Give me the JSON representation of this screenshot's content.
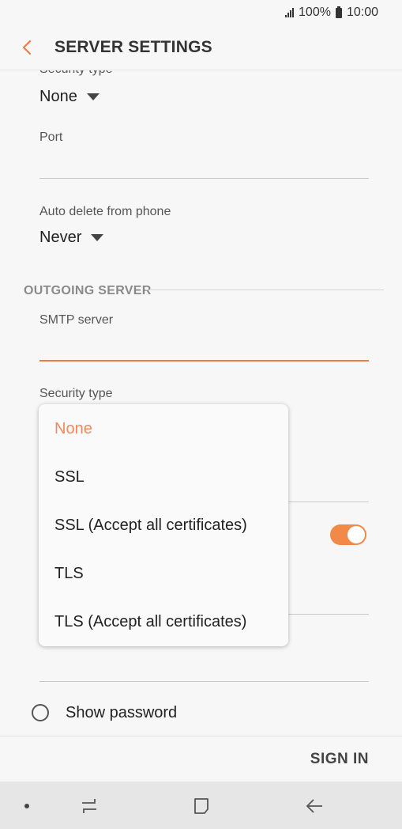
{
  "status": {
    "battery": "100%",
    "time": "10:00"
  },
  "header": {
    "title": "SERVER SETTINGS"
  },
  "incoming": {
    "security_label": "Security type",
    "security_value": "None",
    "port_label": "Port",
    "auto_delete_label": "Auto delete from phone",
    "auto_delete_value": "Never"
  },
  "outgoing": {
    "section_title": "OUTGOING SERVER",
    "smtp_label": "SMTP server",
    "security_label": "Security type"
  },
  "dropdown": {
    "options": [
      "None",
      "SSL",
      "SSL (Accept all certificates)",
      "TLS",
      "TLS (Accept all certificates)"
    ],
    "selected": "None"
  },
  "show_password": {
    "label": "Show password"
  },
  "footer": {
    "sign_in": "SIGN IN"
  },
  "colors": {
    "accent": "#ef7a46",
    "background": "#f7f7f7"
  },
  "icons": [
    "back-arrow-icon",
    "signal-icon",
    "battery-icon",
    "recent-apps-icon",
    "home-icon",
    "nav-back-icon"
  ]
}
